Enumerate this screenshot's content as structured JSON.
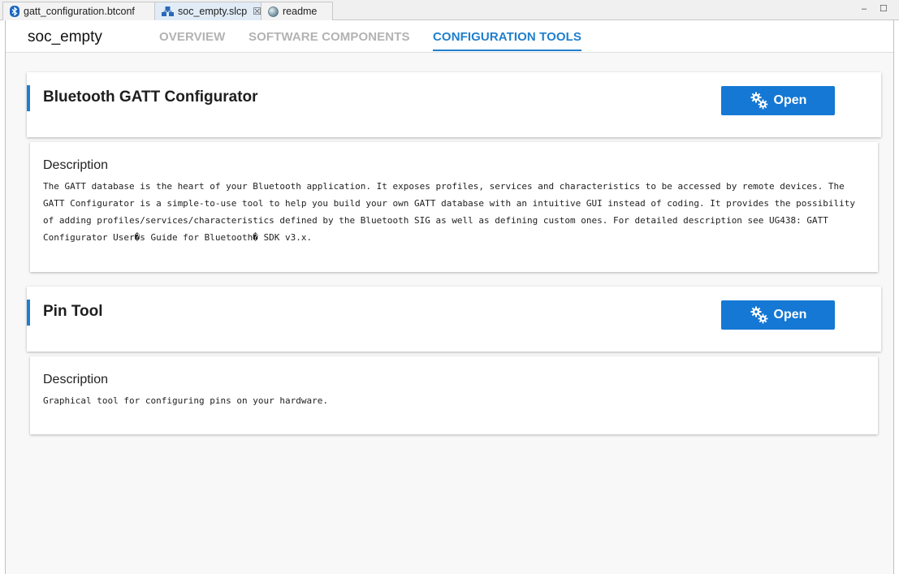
{
  "editor_tabs": [
    {
      "label": "gatt_configuration.btconf",
      "icon": "bluetooth-icon"
    },
    {
      "label": "soc_empty.slcp",
      "icon": "project-icon"
    },
    {
      "label": "readme",
      "icon": "globe-icon"
    }
  ],
  "header": {
    "project": "soc_empty",
    "tabs": [
      "OVERVIEW",
      "SOFTWARE COMPONENTS",
      "CONFIGURATION TOOLS"
    ],
    "active_tab": "CONFIGURATION TOOLS"
  },
  "tools": [
    {
      "title": "Bluetooth GATT Configurator",
      "button": "Open",
      "description_label": "Description",
      "description": "The GATT database is the heart of your Bluetooth application. It exposes profiles, services and characteristics to be accessed by remote devices. The GATT Configurator is a simple-to-use tool to help you build your own GATT database with an intuitive GUI instead of coding. It provides the possibility of adding profiles/services/characteristics defined by the Bluetooth SIG as well as defining custom ones. For detailed description see UG438: GATT Configurator User�s Guide for Bluetooth� SDK v3.x."
    },
    {
      "title": "Pin Tool",
      "button": "Open",
      "description_label": "Description",
      "description": "Graphical tool for configuring pins on your hardware."
    }
  ],
  "colors": {
    "accent": "#1f7fcd",
    "button": "#1478d4",
    "inactive_tab": "#b3b3b3"
  }
}
